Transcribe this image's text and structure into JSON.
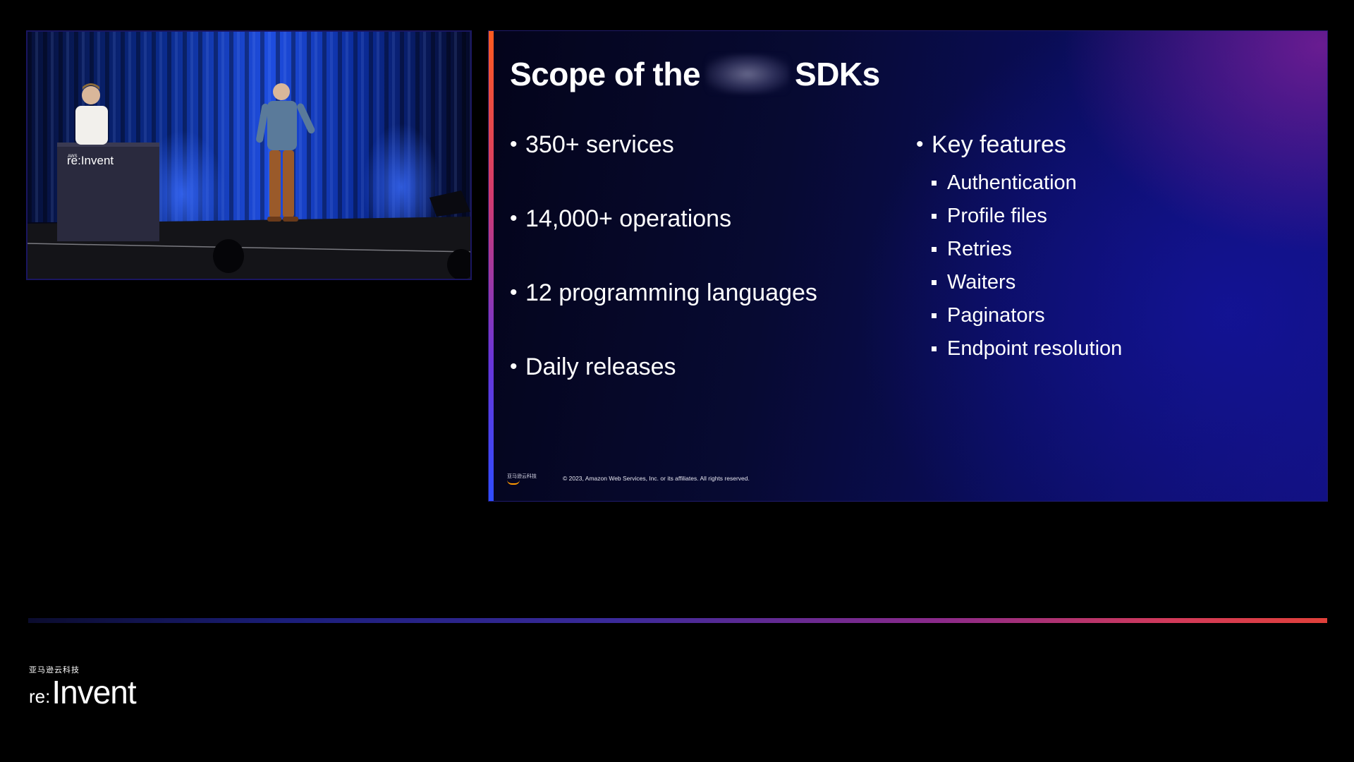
{
  "video": {
    "podium_brand_small": "AWS",
    "podium_brand": "re:Invent"
  },
  "slide": {
    "title_prefix": "Scope of the",
    "title_suffix": "SDKs",
    "left_bullets": [
      "350+ services",
      "14,000+ operations",
      "12 programming languages",
      "Daily releases"
    ],
    "right_heading": "Key features",
    "right_items": [
      "Authentication",
      "Profile files",
      "Retries",
      "Waiters",
      "Paginators",
      "Endpoint resolution"
    ],
    "footer_logo_text": "亚马逊云科技",
    "copyright": "© 2023, Amazon Web Services, Inc. or its affiliates. All rights reserved."
  },
  "branding": {
    "cn_label": "亚马逊云科技",
    "re": "re:",
    "invent": "Invent"
  },
  "colors": {
    "accent_top": "#ff5a1f",
    "accent_bottom": "#2f4dff",
    "slide_bg": "#0a0d5a",
    "page_bg": "#000000"
  }
}
